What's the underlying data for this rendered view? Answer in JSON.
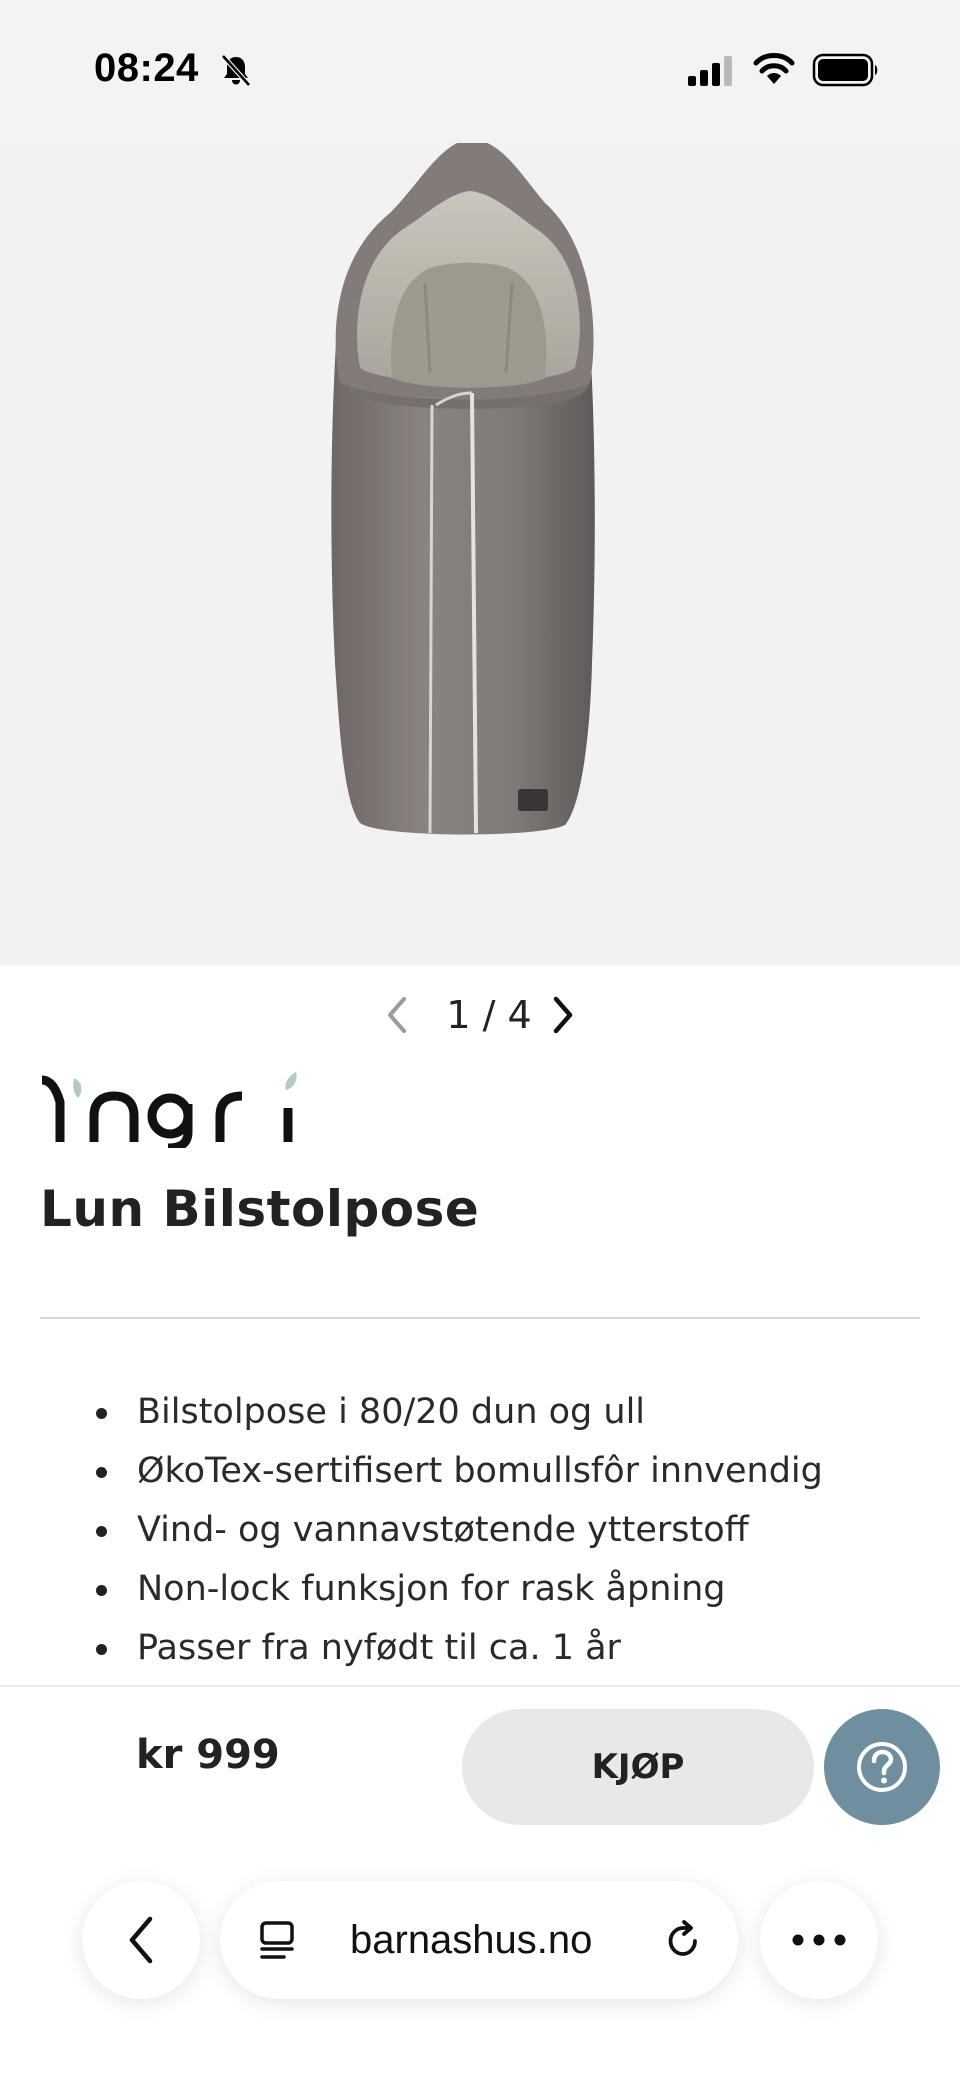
{
  "status_bar": {
    "time": "08:24",
    "icons": [
      "bell-slash-icon",
      "signal-icon",
      "wifi-icon",
      "battery-icon"
    ]
  },
  "gallery": {
    "current": 1,
    "total": 4,
    "counter_text": "1 / 4",
    "prev_icon": "chevron-left-icon",
    "next_icon": "chevron-right-icon"
  },
  "product": {
    "brand": "Yngri",
    "title": "Lun Bilstolpose",
    "features": [
      "Bilstolpose i 80/20 dun og ull",
      "ØkoTex-sertifisert bomullsfôr innvendig",
      "Vind- og vannavstøtende ytterstoff",
      "Non-lock funksjon for rask åpning",
      "Passer fra nyfødt til ca. 1 år"
    ],
    "price": "kr 999",
    "buy_label": "KJØP",
    "help_icon": "question-mark-icon"
  },
  "browser": {
    "url": "barnashus.no",
    "icons": [
      "back-arrow-icon",
      "reader-icon",
      "reload-icon",
      "more-dots-icon"
    ]
  },
  "colors": {
    "help_button": "#6f8f9e",
    "buy_button": "#e8e8e8",
    "image_background": "#f2f2f2"
  }
}
